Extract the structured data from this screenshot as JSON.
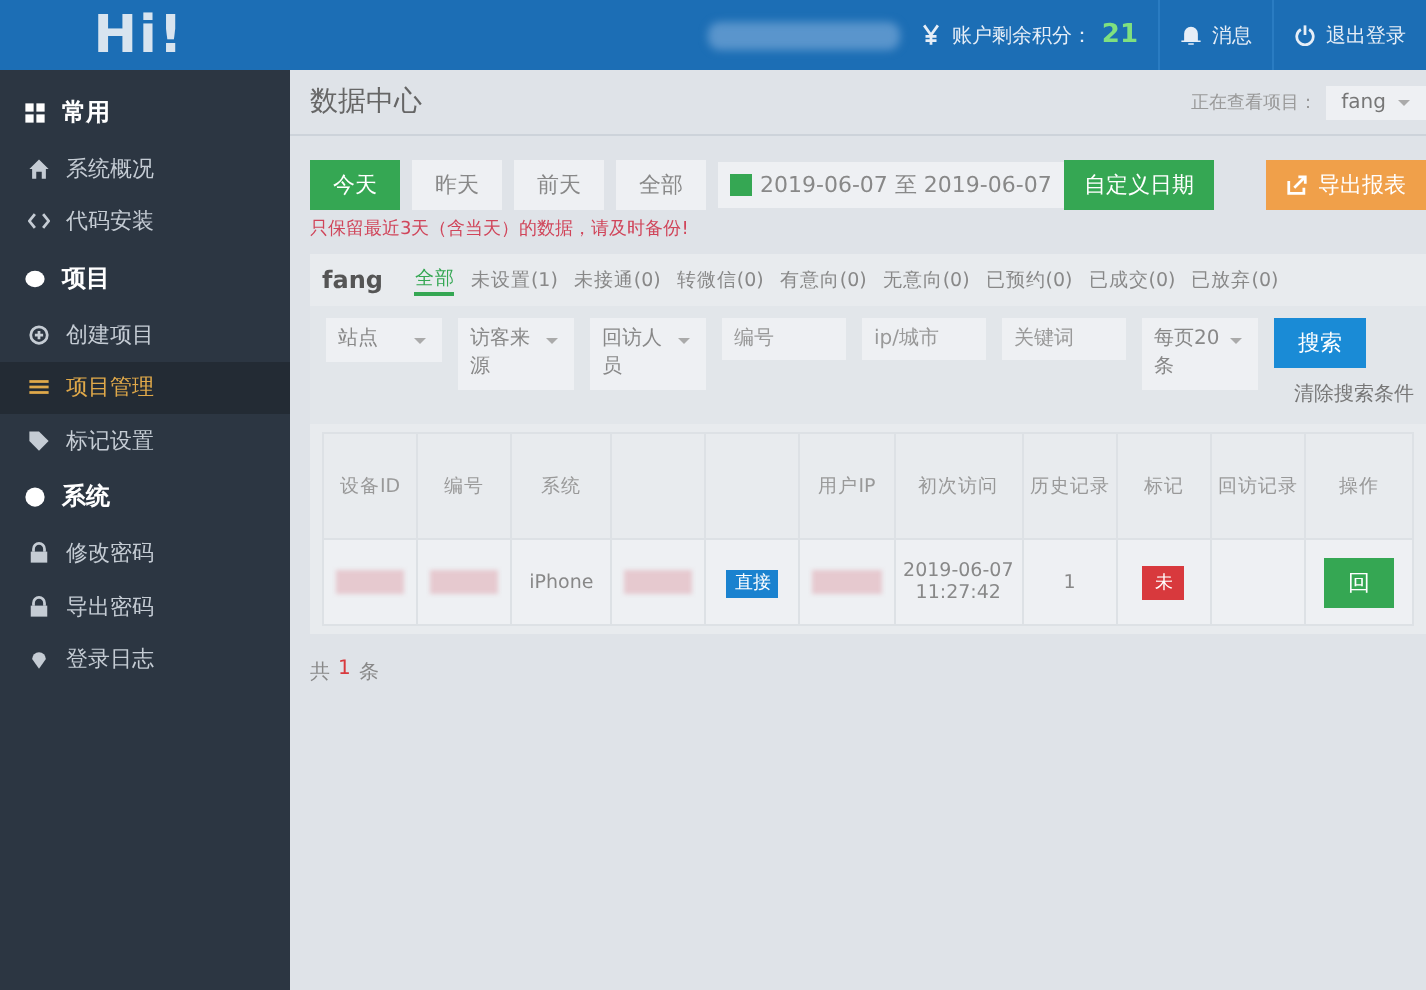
{
  "header": {
    "logo": "Hi!",
    "points_label": "账户剩余积分：",
    "points": "21",
    "messages": "消息",
    "logout": "退出登录"
  },
  "sidebar": {
    "sections": [
      {
        "title": "常用",
        "items": [
          {
            "label": "系统概况",
            "selected": false
          },
          {
            "label": "代码安装",
            "selected": false
          }
        ]
      },
      {
        "title": "项目",
        "items": [
          {
            "label": "创建项目",
            "selected": false
          },
          {
            "label": "项目管理",
            "selected": true
          },
          {
            "label": "标记设置",
            "selected": false
          }
        ]
      },
      {
        "title": "系统",
        "items": [
          {
            "label": "修改密码",
            "selected": false
          },
          {
            "label": "导出密码",
            "selected": false
          },
          {
            "label": "登录日志",
            "selected": false
          }
        ]
      }
    ]
  },
  "page": {
    "title": "数据中心",
    "project_label": "正在查看项目：",
    "project": "fang"
  },
  "date_buttons": [
    {
      "label": "今天",
      "selected": true
    },
    {
      "label": "昨天",
      "selected": false
    },
    {
      "label": "前天",
      "selected": false
    },
    {
      "label": "全部",
      "selected": false
    }
  ],
  "date_range": "2019-06-07 至 2019-06-07",
  "custom_date": "自定义日期",
  "export": "导出报表",
  "notice": "只保留最近3天（含当天）的数据，请及时备份!",
  "panel": {
    "title": "fang",
    "tabs": [
      {
        "label": "全部",
        "selected": true
      },
      {
        "label": "未设置(1)",
        "selected": false
      },
      {
        "label": "未接通(0)",
        "selected": false
      },
      {
        "label": "转微信(0)",
        "selected": false
      },
      {
        "label": "有意向(0)",
        "selected": false
      },
      {
        "label": "无意向(0)",
        "selected": false
      },
      {
        "label": "已预约(0)",
        "selected": false
      },
      {
        "label": "已成交(0)",
        "selected": false
      },
      {
        "label": "已放弃(0)",
        "selected": false
      }
    ]
  },
  "filters": [
    {
      "kind": "select",
      "value": "站点"
    },
    {
      "kind": "select",
      "value": "访客来源"
    },
    {
      "kind": "select",
      "value": "回访人员"
    },
    {
      "kind": "input",
      "placeholder": "编号"
    },
    {
      "kind": "input",
      "placeholder": "ip/城市"
    },
    {
      "kind": "input",
      "placeholder": "关键词"
    },
    {
      "kind": "select",
      "value": "每页20条"
    }
  ],
  "search": "搜索",
  "clear": "清除搜索条件",
  "table": {
    "columns": [
      {
        "label": "设备ID"
      },
      {
        "label": "编号"
      },
      {
        "label": "系统"
      },
      {},
      {},
      {
        "label": "用户IP"
      },
      {
        "label": "初次访问"
      },
      {
        "label": "历史记录"
      },
      {
        "label": "标记"
      },
      {
        "label": "回访记录"
      },
      {
        "label": "操作"
      }
    ],
    "rows": [
      {
        "cells": [
          {
            "kind": "redacted"
          },
          {
            "kind": "redacted"
          },
          {
            "kind": "text",
            "text": "iPhone"
          },
          {
            "kind": "redacted"
          },
          {
            "kind": "badge",
            "text": "直接"
          },
          {
            "kind": "redacted"
          },
          {
            "kind": "text",
            "text": "2019-06-07 11:27:42"
          },
          {
            "kind": "text",
            "text": "1"
          },
          {
            "kind": "mark",
            "text": "未"
          },
          {
            "kind": "empty"
          },
          {
            "kind": "action",
            "text": "回"
          }
        ]
      }
    ]
  },
  "footer": {
    "prefix": "共",
    "count": "1",
    "suffix": "条"
  }
}
